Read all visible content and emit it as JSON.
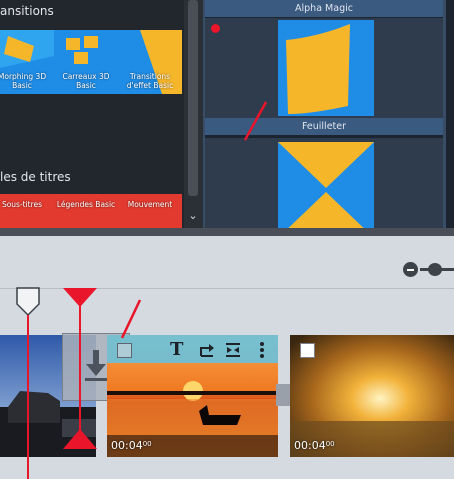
{
  "media_pool": {
    "section_transitions": "ansitions",
    "section_titles": "les de titres",
    "transition_tiles": [
      {
        "label": "Morphing 3D Basic"
      },
      {
        "label": "Carreaux 3D Basic"
      },
      {
        "label": "Transitions d'effet Basic"
      }
    ],
    "title_tiles": [
      {
        "label": "Sous-titres"
      },
      {
        "label": "Légendes Basic"
      },
      {
        "label": "Mouvement"
      }
    ]
  },
  "preview_grid": {
    "cells": [
      {
        "title": "Alpha Magic"
      },
      {
        "title": "Feuilleter"
      }
    ]
  },
  "timeline": {
    "clips": [
      {
        "duration": "00:04",
        "duration_frames": "00"
      },
      {
        "duration": "00:04",
        "duration_frames": "00"
      }
    ]
  },
  "icons": {
    "scroll_down": "chevron-down-icon",
    "zoom_out": "minus-circle-icon",
    "text": "text-icon",
    "rotate": "rotate-icon",
    "split": "split-icon",
    "more": "more-vertical-icon",
    "insert": "insert-download-icon"
  },
  "colors": {
    "accent_red": "#e8152b",
    "title_bar": "#3a5a80",
    "pool_bg": "#22262d",
    "timeline_bg": "#d5d9e0",
    "tile_blue": "#1f8de6",
    "tile_yellow": "#f6b62a"
  }
}
